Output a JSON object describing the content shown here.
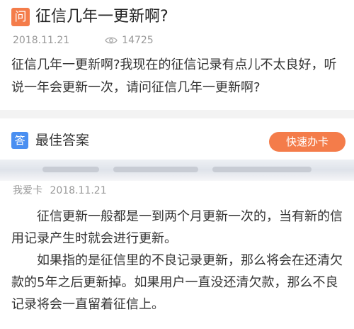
{
  "question": {
    "badge": "问",
    "title": "征信几年一更新啊?",
    "date": "2018.11.21",
    "views": "14725",
    "body": "征信几年一更新啊?我现在的征信记录有点儿不太良好，听说一年会更新一次，请问征信几年一更新啊?"
  },
  "answer": {
    "badge": "答",
    "title": "最佳答案",
    "quick_button": "快速办卡",
    "user": "我爱卡",
    "date": "2018.11.21",
    "paragraphs": [
      "征信更新一般都是一到两个月更新一次的，当有新的信用记录产生时就会进行更新。",
      "如果指的是征信里的不良记录更新，那么将会在还清欠款的5年之后更新掉。如果用户一直没还清欠款，那么不良记录将会一直留着征信上。"
    ]
  },
  "colors": {
    "question_badge": "#f47c4a",
    "answer_badge": "#4a8ff1",
    "quick_button": "#f47c4a",
    "meta_text": "#999999",
    "divider": "#f3f3f3"
  },
  "icons": {
    "views": "eye-icon"
  }
}
